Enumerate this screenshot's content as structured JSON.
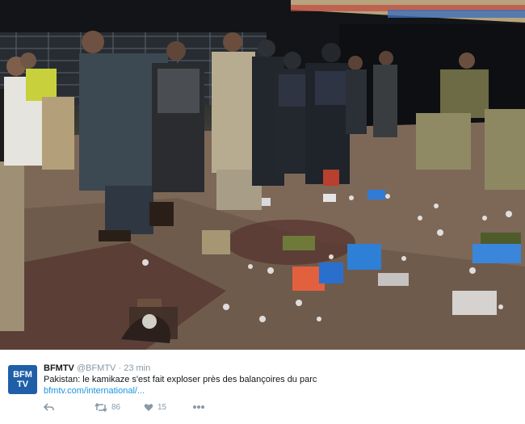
{
  "photo": {
    "subject": "photo-scene"
  },
  "tweet": {
    "avatar_text": "BFM TV",
    "author_name": "BFMTV",
    "author_handle": "@BFMTV",
    "separator": "·",
    "time": "23 min",
    "text": "Pakistan: le kamikaze s'est fait exploser près des balançoires du parc",
    "link": "bfmtv.com/international/...",
    "retweet_count": "86",
    "like_count": "15"
  },
  "icons": [
    "reply-icon",
    "retweet-icon",
    "heart-icon",
    "more-icon"
  ],
  "colors": {
    "brand": "#1f5fa8",
    "link": "#1b95e0",
    "muted": "#8899a6",
    "text": "#14171a"
  }
}
